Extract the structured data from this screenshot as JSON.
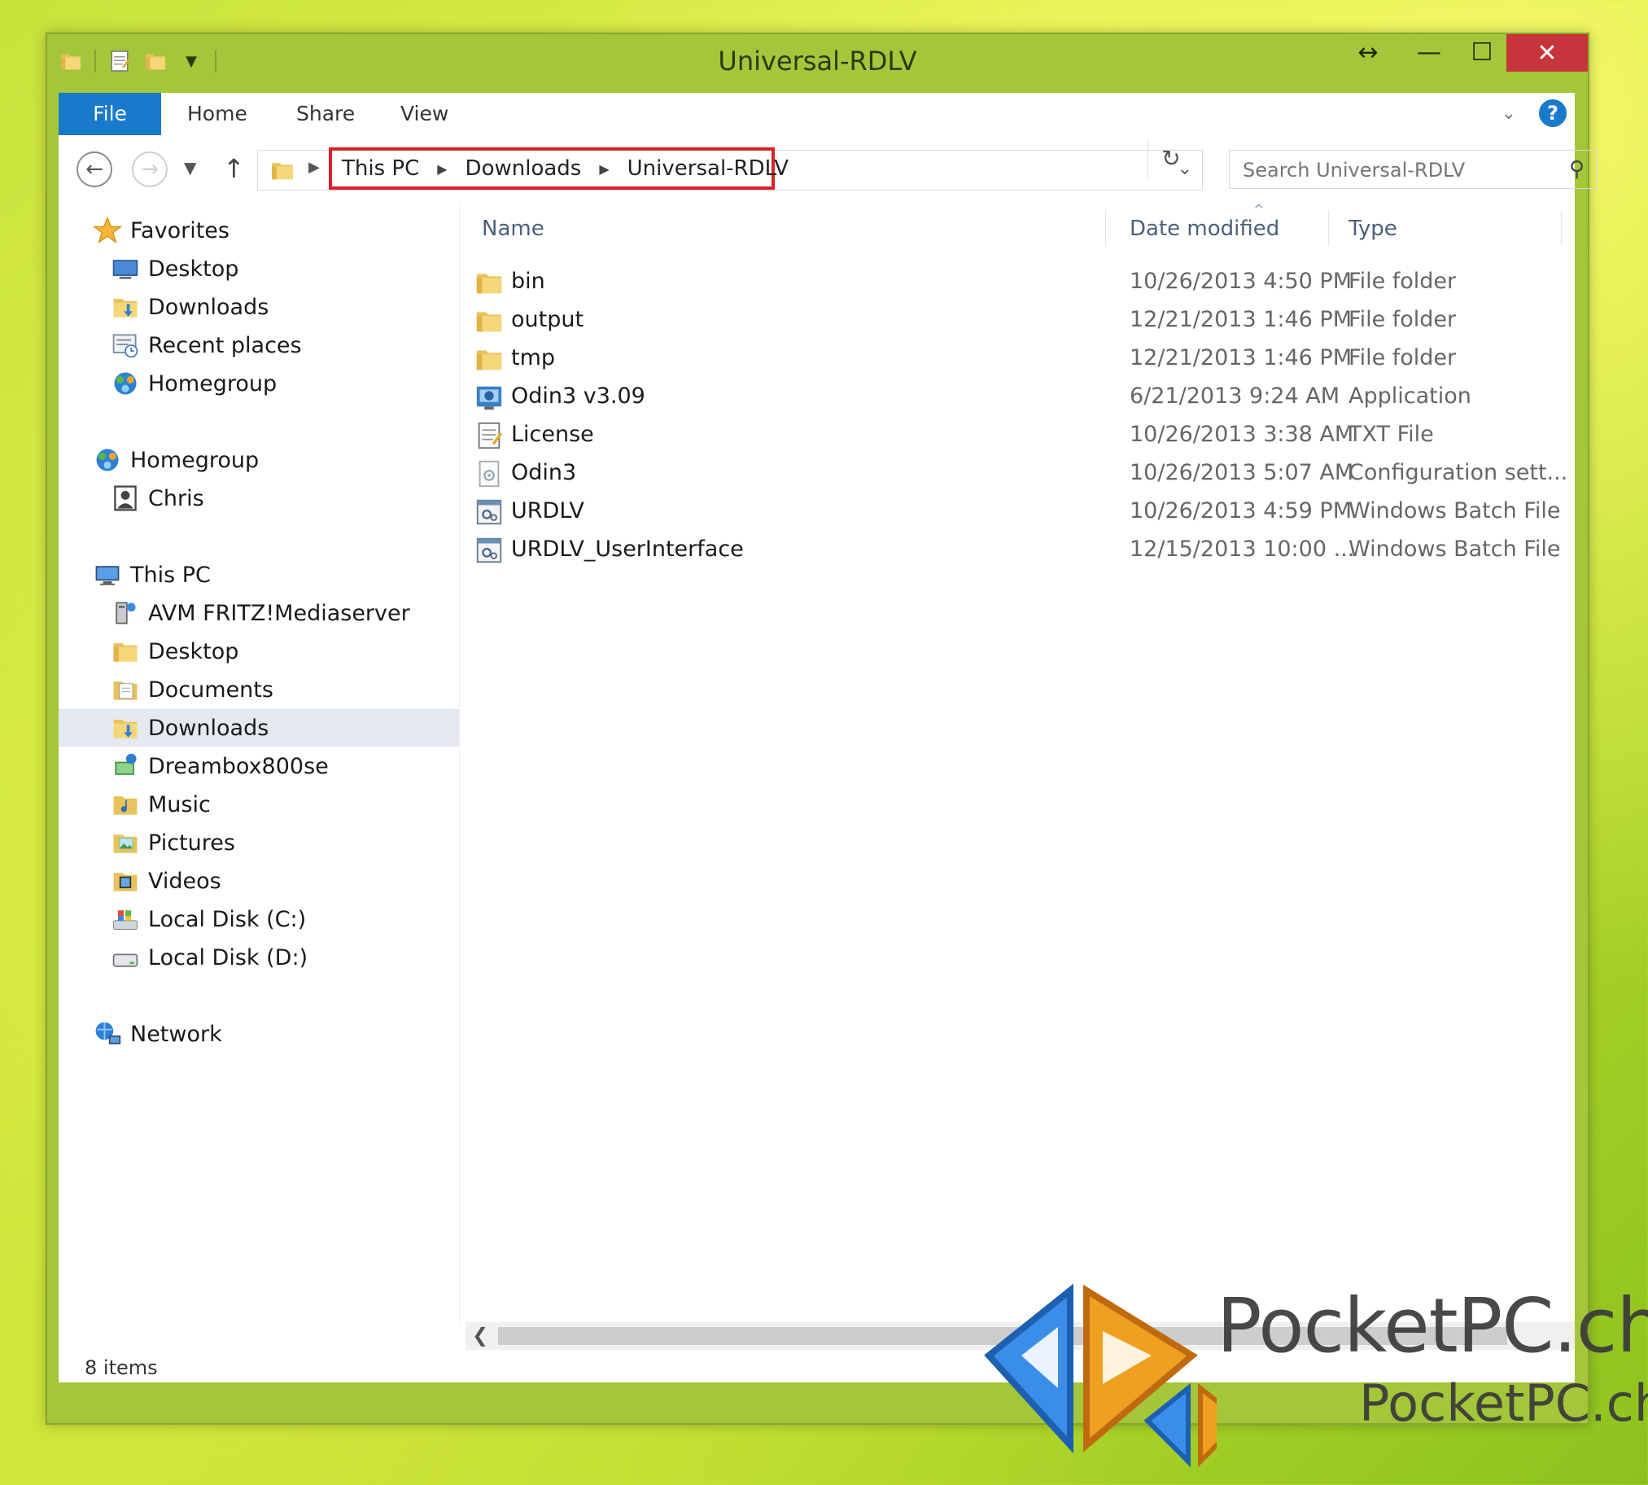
{
  "window": {
    "title": "Universal-RDLV",
    "buttons": {
      "resize": "↔",
      "minimize": "—",
      "maximize": "☐",
      "close": "✕"
    }
  },
  "ribbon": {
    "tabs": [
      "File",
      "Home",
      "Share",
      "View"
    ],
    "help": "?"
  },
  "address": {
    "crumbs": [
      "This PC",
      "Downloads",
      "Universal-RDLV"
    ]
  },
  "search": {
    "placeholder": "Search Universal-RDLV"
  },
  "sidebar": {
    "favorites": {
      "label": "Favorites",
      "items": [
        "Desktop",
        "Downloads",
        "Recent places",
        "Homegroup"
      ]
    },
    "homegroup": {
      "label": "Homegroup",
      "items": [
        "Chris"
      ]
    },
    "thispc": {
      "label": "This PC",
      "items": [
        "AVM FRITZ!Mediaserver",
        "Desktop",
        "Documents",
        "Downloads",
        "Dreambox800se",
        "Music",
        "Pictures",
        "Videos",
        "Local Disk (C:)",
        "Local Disk (D:)"
      ],
      "selected": "Downloads"
    },
    "network": {
      "label": "Network"
    }
  },
  "columns": {
    "name": "Name",
    "date": "Date modified",
    "type": "Type"
  },
  "files": [
    {
      "name": "bin",
      "date": "10/26/2013 4:50 PM",
      "type": "File folder",
      "icon": "folder-icon"
    },
    {
      "name": "output",
      "date": "12/21/2013 1:46 PM",
      "type": "File folder",
      "icon": "folder-icon"
    },
    {
      "name": "tmp",
      "date": "12/21/2013 1:46 PM",
      "type": "File folder",
      "icon": "folder-icon"
    },
    {
      "name": "Odin3 v3.09",
      "date": "6/21/2013 9:24 AM",
      "type": "Application",
      "icon": "application-icon"
    },
    {
      "name": "License",
      "date": "10/26/2013 3:38 AM",
      "type": "TXT File",
      "icon": "text-file-icon"
    },
    {
      "name": "Odin3",
      "date": "10/26/2013 5:07 AM",
      "type": "Configuration sett...",
      "icon": "config-file-icon"
    },
    {
      "name": "URDLV",
      "date": "10/26/2013 4:59 PM",
      "type": "Windows Batch File",
      "icon": "batch-file-icon"
    },
    {
      "name": "URDLV_UserInterface",
      "date": "12/15/2013 10:00 ...",
      "type": "Windows Batch File",
      "icon": "batch-file-icon"
    }
  ],
  "status": {
    "item_count": "8 items"
  },
  "watermark": {
    "text_large": "PocketPC.ch",
    "text_small": "PocketPC.ch"
  },
  "colors": {
    "title_bar": "#a4c63a",
    "file_tab": "#1979ca",
    "close_button": "#c7343b",
    "address_highlight": "#d8222a",
    "selected_item": "#e5eaf0"
  }
}
